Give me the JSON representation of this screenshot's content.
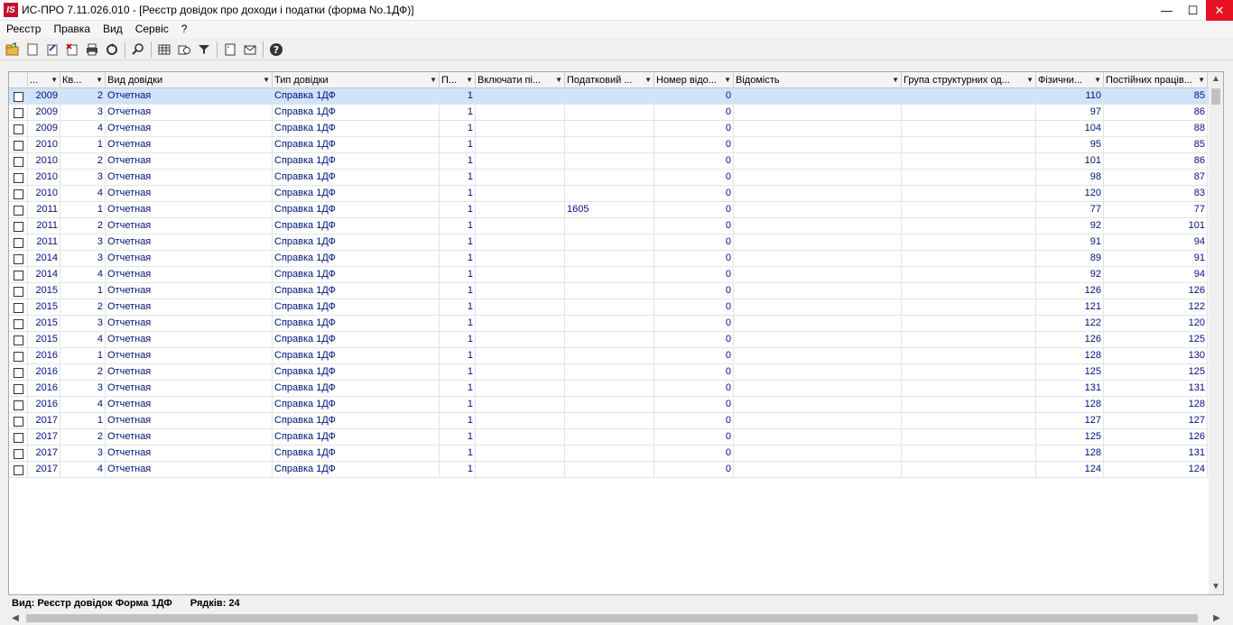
{
  "window": {
    "title": "ИС-ПРО 7.11.026.010 - [Реєстр довідок про доходи і податки (форма No.1ДФ)]",
    "logo_text": "IS",
    "minimize": "—",
    "maximize": "☐",
    "close": "✕"
  },
  "menu": [
    "Реєстр",
    "Правка",
    "Вид",
    "Сервіс",
    "?"
  ],
  "toolbar": [
    "open-icon",
    "new-icon",
    "edit-icon",
    "delete-icon",
    "print-icon",
    "refresh-icon",
    "search-icon",
    "grid-icon",
    "copy-icon",
    "filter-icon",
    "page-icon",
    "mail-icon",
    "help-icon"
  ],
  "columns": [
    "...",
    "Кв...",
    "Вид довідки",
    "Тип довідки",
    "П...",
    "Включати пі...",
    "Податковий ...",
    "Номер відо...",
    "Відомість",
    "Група структурних од...",
    "Фізични...",
    "Постійних праців..."
  ],
  "rows": [
    {
      "year": "2009",
      "q": "2",
      "kind": "Отчетная",
      "type": "Справка 1ДФ",
      "p": "1",
      "inc": "",
      "tax": "",
      "num": "0",
      "stmt": "",
      "grp": "",
      "phys": "110",
      "perm": "85"
    },
    {
      "year": "2009",
      "q": "3",
      "kind": "Отчетная",
      "type": "Справка 1ДФ",
      "p": "1",
      "inc": "",
      "tax": "",
      "num": "0",
      "stmt": "",
      "grp": "",
      "phys": "97",
      "perm": "86"
    },
    {
      "year": "2009",
      "q": "4",
      "kind": "Отчетная",
      "type": "Справка 1ДФ",
      "p": "1",
      "inc": "",
      "tax": "",
      "num": "0",
      "stmt": "",
      "grp": "",
      "phys": "104",
      "perm": "88"
    },
    {
      "year": "2010",
      "q": "1",
      "kind": "Отчетная",
      "type": "Справка 1ДФ",
      "p": "1",
      "inc": "",
      "tax": "",
      "num": "0",
      "stmt": "",
      "grp": "",
      "phys": "95",
      "perm": "85"
    },
    {
      "year": "2010",
      "q": "2",
      "kind": "Отчетная",
      "type": "Справка 1ДФ",
      "p": "1",
      "inc": "",
      "tax": "",
      "num": "0",
      "stmt": "",
      "grp": "",
      "phys": "101",
      "perm": "86"
    },
    {
      "year": "2010",
      "q": "3",
      "kind": "Отчетная",
      "type": "Справка 1ДФ",
      "p": "1",
      "inc": "",
      "tax": "",
      "num": "0",
      "stmt": "",
      "grp": "",
      "phys": "98",
      "perm": "87"
    },
    {
      "year": "2010",
      "q": "4",
      "kind": "Отчетная",
      "type": "Справка 1ДФ",
      "p": "1",
      "inc": "",
      "tax": "",
      "num": "0",
      "stmt": "",
      "grp": "",
      "phys": "120",
      "perm": "83"
    },
    {
      "year": "2011",
      "q": "1",
      "kind": "Отчетная",
      "type": "Справка 1ДФ",
      "p": "1",
      "inc": "",
      "tax": "1605",
      "num": "0",
      "stmt": "",
      "grp": "",
      "phys": "77",
      "perm": "77"
    },
    {
      "year": "2011",
      "q": "2",
      "kind": "Отчетная",
      "type": "Справка 1ДФ",
      "p": "1",
      "inc": "",
      "tax": "",
      "num": "0",
      "stmt": "",
      "grp": "",
      "phys": "92",
      "perm": "101"
    },
    {
      "year": "2011",
      "q": "3",
      "kind": "Отчетная",
      "type": "Справка 1ДФ",
      "p": "1",
      "inc": "",
      "tax": "",
      "num": "0",
      "stmt": "",
      "grp": "",
      "phys": "91",
      "perm": "94"
    },
    {
      "year": "2014",
      "q": "3",
      "kind": "Отчетная",
      "type": "Справка 1ДФ",
      "p": "1",
      "inc": "",
      "tax": "",
      "num": "0",
      "stmt": "",
      "grp": "",
      "phys": "89",
      "perm": "91"
    },
    {
      "year": "2014",
      "q": "4",
      "kind": "Отчетная",
      "type": "Справка 1ДФ",
      "p": "1",
      "inc": "",
      "tax": "",
      "num": "0",
      "stmt": "",
      "grp": "",
      "phys": "92",
      "perm": "94"
    },
    {
      "year": "2015",
      "q": "1",
      "kind": "Отчетная",
      "type": "Справка 1ДФ",
      "p": "1",
      "inc": "",
      "tax": "",
      "num": "0",
      "stmt": "",
      "grp": "",
      "phys": "126",
      "perm": "126"
    },
    {
      "year": "2015",
      "q": "2",
      "kind": "Отчетная",
      "type": "Справка 1ДФ",
      "p": "1",
      "inc": "",
      "tax": "",
      "num": "0",
      "stmt": "",
      "grp": "",
      "phys": "121",
      "perm": "122"
    },
    {
      "year": "2015",
      "q": "3",
      "kind": "Отчетная",
      "type": "Справка 1ДФ",
      "p": "1",
      "inc": "",
      "tax": "",
      "num": "0",
      "stmt": "",
      "grp": "",
      "phys": "122",
      "perm": "120"
    },
    {
      "year": "2015",
      "q": "4",
      "kind": "Отчетная",
      "type": "Справка 1ДФ",
      "p": "1",
      "inc": "",
      "tax": "",
      "num": "0",
      "stmt": "",
      "grp": "",
      "phys": "126",
      "perm": "125"
    },
    {
      "year": "2016",
      "q": "1",
      "kind": "Отчетная",
      "type": "Справка 1ДФ",
      "p": "1",
      "inc": "",
      "tax": "",
      "num": "0",
      "stmt": "",
      "grp": "",
      "phys": "128",
      "perm": "130"
    },
    {
      "year": "2016",
      "q": "2",
      "kind": "Отчетная",
      "type": "Справка 1ДФ",
      "p": "1",
      "inc": "",
      "tax": "",
      "num": "0",
      "stmt": "",
      "grp": "",
      "phys": "125",
      "perm": "125"
    },
    {
      "year": "2016",
      "q": "3",
      "kind": "Отчетная",
      "type": "Справка 1ДФ",
      "p": "1",
      "inc": "",
      "tax": "",
      "num": "0",
      "stmt": "",
      "grp": "",
      "phys": "131",
      "perm": "131"
    },
    {
      "year": "2016",
      "q": "4",
      "kind": "Отчетная",
      "type": "Справка 1ДФ",
      "p": "1",
      "inc": "",
      "tax": "",
      "num": "0",
      "stmt": "",
      "grp": "",
      "phys": "128",
      "perm": "128"
    },
    {
      "year": "2017",
      "q": "1",
      "kind": "Отчетная",
      "type": "Справка 1ДФ",
      "p": "1",
      "inc": "",
      "tax": "",
      "num": "0",
      "stmt": "",
      "grp": "",
      "phys": "127",
      "perm": "127"
    },
    {
      "year": "2017",
      "q": "2",
      "kind": "Отчетная",
      "type": "Справка 1ДФ",
      "p": "1",
      "inc": "",
      "tax": "",
      "num": "0",
      "stmt": "",
      "grp": "",
      "phys": "125",
      "perm": "126"
    },
    {
      "year": "2017",
      "q": "3",
      "kind": "Отчетная",
      "type": "Справка 1ДФ",
      "p": "1",
      "inc": "",
      "tax": "",
      "num": "0",
      "stmt": "",
      "grp": "",
      "phys": "128",
      "perm": "131"
    },
    {
      "year": "2017",
      "q": "4",
      "kind": "Отчетная",
      "type": "Справка 1ДФ",
      "p": "1",
      "inc": "",
      "tax": "",
      "num": "0",
      "stmt": "",
      "grp": "",
      "phys": "124",
      "perm": "124"
    }
  ],
  "status": {
    "view": "Вид: Реєстр довідок Форма 1ДФ",
    "rows": "Рядків: 24"
  },
  "colors": {
    "selected_row": "#cfe3fb",
    "cell_text": "#00127a",
    "close_button": "#e81123",
    "logo": "#c8102e"
  }
}
